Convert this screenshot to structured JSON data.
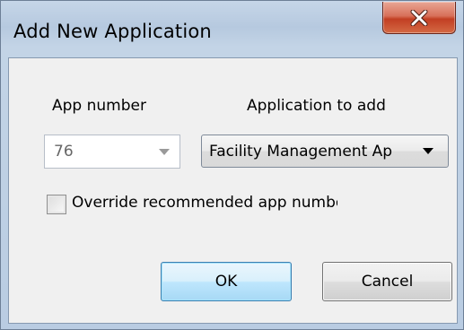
{
  "window": {
    "title": "Add New Application"
  },
  "form": {
    "app_number_label": "App number",
    "app_to_add_label": "Application to add",
    "app_number_value": "76",
    "app_to_add_value": "Facility Management Ap",
    "override_label": "Override recommended app number",
    "override_checked": false
  },
  "buttons": {
    "ok_label": "OK",
    "cancel_label": "Cancel"
  },
  "icons": {
    "close": "close-icon",
    "dropdown": "chevron-down-icon"
  },
  "colors": {
    "frame": "#b9cce2",
    "close_button": "#c23f23",
    "dialog_background": "#f0f0f0",
    "default_button_border": "#3c7fb1"
  }
}
